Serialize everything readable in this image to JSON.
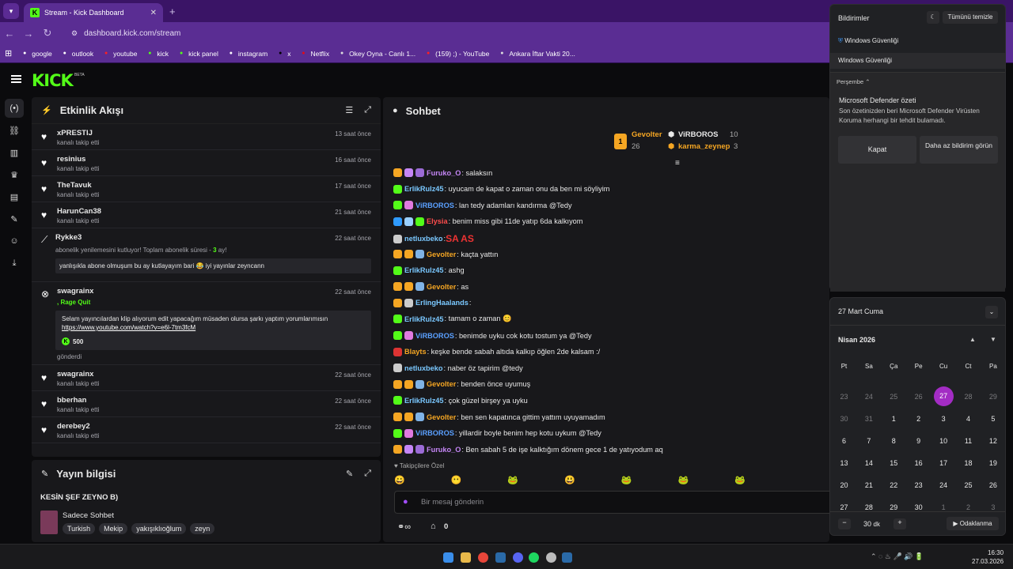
{
  "browser": {
    "tab_title": "Stream - Kick Dashboard",
    "url": "dashboard.kick.com/stream",
    "bookmarks": [
      {
        "label": "google",
        "color": "#fff"
      },
      {
        "label": "outlook",
        "color": "#fff"
      },
      {
        "label": "youtube",
        "color": "#ff2020"
      },
      {
        "label": "kick",
        "color": "#53fc18"
      },
      {
        "label": "kick panel",
        "color": "#53fc18"
      },
      {
        "label": "instagram",
        "color": "#fff"
      },
      {
        "label": "x",
        "color": "#000"
      },
      {
        "label": "Netflix",
        "color": "#e50914"
      },
      {
        "label": "Okey Oyna - Canlı 1...",
        "color": "#ddd"
      },
      {
        "label": "(159) ;) - YouTube",
        "color": "#ff2020"
      },
      {
        "label": "Ankara İftar Vakti 20...",
        "color": "#ddd"
      }
    ]
  },
  "kick": {
    "logo": "KICK",
    "beta": "BETA"
  },
  "activity": {
    "title": "Etkinlik Akışı",
    "items": [
      {
        "name": "xPRESTIJ",
        "sub": "kanalı takip etti",
        "time": "13 saat önce"
      },
      {
        "name": "resinius",
        "sub": "kanalı takip etti",
        "time": "16 saat önce"
      },
      {
        "name": "TheTavuk",
        "sub": "kanalı takip etti",
        "time": "17 saat önce"
      },
      {
        "name": "HarunCan38",
        "sub": "kanalı takip etti",
        "time": "21 saat önce"
      }
    ],
    "sub_event": {
      "name": "Rykke3",
      "line_a": "abonelik yenilemesini kutluyor! Toplam abonelik süresi - ",
      "months": "3",
      "line_b": " ay!",
      "quote": "yanlışıkla abone olmuşum bu ay kutlayayım bari 😂 iyi yayınlar zeyncann",
      "time": "22 saat önce"
    },
    "rage_event": {
      "name": "swagrainx",
      "rage": ", Rage Quit",
      "quote": "Selam yayıncılardan klip alıyorum edit yapacağım müsaden olursa şarkı yaptım yorumlarımısın",
      "link": "https://www.youtube.com/watch?v=e6l-7tm3fcM",
      "kicks": "500",
      "sent": "gönderdi",
      "time": "22 saat önce"
    },
    "items2": [
      {
        "name": "swagrainx",
        "sub": "kanalı takip etti",
        "time": "22 saat önce"
      },
      {
        "name": "bberhan",
        "sub": "kanalı takip etti",
        "time": "22 saat önce"
      },
      {
        "name": "derebey2",
        "sub": "kanalı takip etti",
        "time": "22 saat önce"
      }
    ]
  },
  "stream_info": {
    "title": "Yayın bilgisi",
    "stream_title": "KESİN ŞEF ZEYNO B)",
    "category": "Sadece Sohbet",
    "tags": [
      "Turkish",
      "Mekip",
      "yakışıklıoğlum",
      "zeyn"
    ]
  },
  "chat": {
    "title": "Sohbet",
    "leaders": [
      {
        "rank": "1",
        "name": "Gevolter",
        "count": "26"
      },
      {
        "name": "ViRBOROS",
        "count": "10"
      },
      {
        "name": "karma_zeynep",
        "count": "3"
      }
    ],
    "messages": [
      {
        "user": "Furuko_O",
        "color": "#c586f6",
        "text": ": salaksın",
        "badges": [
          "#f5a623",
          "#c586f6",
          "#9b6bd6"
        ]
      },
      {
        "user": "ErlikRulz45",
        "color": "#7ac8ff",
        "text": ": uyucam de kapat o zaman onu da ben mi söyliyim",
        "badges": [
          "#53fc18"
        ]
      },
      {
        "user": "ViRBOROS",
        "color": "#5aa0ff",
        "text": ": lan tedy adamları kandırma @Tedy",
        "badges": [
          "#53fc18",
          "#e07adf"
        ]
      },
      {
        "user": "Elysia",
        "color": "#ff4d4d",
        "text": ": benim miss gibi 11de yatıp 6da kalkıyom",
        "badges": [
          "#2f9bff",
          "#9ad0ff",
          "#53fc18"
        ]
      },
      {
        "user": "netluxbeko",
        "color": "#7ac8ff",
        "text": ": ",
        "extra": "SA AS",
        "badges": [
          "#ccc"
        ]
      },
      {
        "user": "Gevolter",
        "color": "#f5a623",
        "text": ": kaçta yattın",
        "badges": [
          "#f5a623",
          "#f5a623",
          "#7fb3e6"
        ]
      },
      {
        "user": "ErlikRulz45",
        "color": "#7ac8ff",
        "text": ": ashg",
        "badges": [
          "#53fc18"
        ]
      },
      {
        "user": "Gevolter",
        "color": "#f5a623",
        "text": ": as",
        "badges": [
          "#f5a623",
          "#f5a623",
          "#7fb3e6"
        ]
      },
      {
        "user": "ErlingHaalands",
        "color": "#7ac8ff",
        "text": ": ",
        "badges": [
          "#f5a623",
          "#ccc"
        ]
      },
      {
        "user": "ErlikRulz45",
        "color": "#7ac8ff",
        "text": ": tamam o zaman 😊",
        "badges": [
          "#53fc18"
        ]
      },
      {
        "user": "ViRBOROS",
        "color": "#5aa0ff",
        "text": ": benimde uyku cok kotu tostum ya @Tedy",
        "badges": [
          "#53fc18",
          "#e07adf"
        ]
      },
      {
        "user": "Blayts",
        "color": "#f5a623",
        "text": ": keşke bende sabah altıda kalkıp öğlen 2de kalsam :/",
        "badges": [
          "#d33"
        ]
      },
      {
        "user": "netluxbeko",
        "color": "#7ac8ff",
        "text": ": naber öz tapirim @tedy",
        "badges": [
          "#ccc"
        ]
      },
      {
        "user": "Gevolter",
        "color": "#f5a623",
        "text": ": benden önce uyumuş",
        "badges": [
          "#f5a623",
          "#f5a623",
          "#7fb3e6"
        ]
      },
      {
        "user": "ErlikRulz45",
        "color": "#7ac8ff",
        "text": ": çok güzel birşey ya uyku",
        "badges": [
          "#53fc18"
        ]
      },
      {
        "user": "Gevolter",
        "color": "#f5a623",
        "text": ": ben sen kapatınca gittim yattım uyuyamadım",
        "badges": [
          "#f5a623",
          "#f5a623",
          "#7fb3e6"
        ]
      },
      {
        "user": "ViRBOROS",
        "color": "#5aa0ff",
        "text": ": yillardir boyle benim hep kotu uykum @Tedy",
        "badges": [
          "#53fc18",
          "#e07adf"
        ]
      },
      {
        "user": "Furuko_O",
        "color": "#c586f6",
        "text": ": Ben sabah 5 de işe kalktığım dönem gece 1 de yatıyodum aq",
        "badges": [
          "#f5a623",
          "#c586f6",
          "#9b6bd6"
        ]
      }
    ],
    "followers_label": "Takipçilere Özel",
    "placeholder": "Bir mesaj gönderin",
    "footer_count": "0"
  },
  "notifications": {
    "title": "Bildirimler",
    "clear": "Tümünü temizle",
    "app": "Windows Güvenliği",
    "app2": "Windows Güvenliği",
    "day": "Perşembe",
    "heading": "Microsoft Defender özeti",
    "body": "Son özetinizden beri Microsoft Defender Virüsten Koruma herhangi bir tehdit bulamadı.",
    "close": "Kapat",
    "less": "Daha az bildirim görün"
  },
  "calendar": {
    "date": "27 Mart Cuma",
    "month": "Nisan 2026",
    "days": [
      "Pt",
      "Sa",
      "Ça",
      "Pe",
      "Cu",
      "Ct",
      "Pa"
    ],
    "weeks": [
      [
        "23",
        "24",
        "25",
        "26",
        "27",
        "28",
        "29"
      ],
      [
        "30",
        "31",
        "1",
        "2",
        "3",
        "4",
        "5"
      ],
      [
        "6",
        "7",
        "8",
        "9",
        "10",
        "11",
        "12"
      ],
      [
        "13",
        "14",
        "15",
        "16",
        "17",
        "18",
        "19"
      ],
      [
        "20",
        "21",
        "22",
        "23",
        "24",
        "25",
        "26"
      ],
      [
        "27",
        "28",
        "29",
        "30",
        "1",
        "2",
        "3"
      ]
    ],
    "focus_minutes": "30",
    "focus_unit": "dk",
    "focus_label": "Odaklanma"
  },
  "taskbar": {
    "time": "16:30",
    "date": "27.03.2026"
  }
}
